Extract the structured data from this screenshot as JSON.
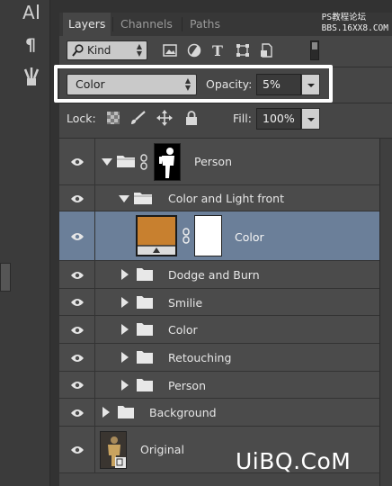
{
  "watermark": {
    "line1": "PS教程论坛",
    "line2": "BBS.16XX8.COM"
  },
  "site_mark": "UiBQ.CoM",
  "toolbar": {
    "tools": [
      {
        "icon": "type-tool-icon"
      },
      {
        "icon": "paragraph-icon"
      },
      {
        "icon": "brush-presets-icon"
      }
    ]
  },
  "tabs": [
    {
      "label": "Layers",
      "active": true
    },
    {
      "label": "Channels",
      "active": false
    },
    {
      "label": "Paths",
      "active": false
    }
  ],
  "filter": {
    "kind_label": "Kind",
    "icons": [
      "image-filter-icon",
      "adjustment-filter-icon",
      "type-filter-icon",
      "shape-filter-icon",
      "smart-object-filter-icon"
    ]
  },
  "blend": {
    "mode": "Color",
    "opacity_label": "Opacity:",
    "opacity_value": "5%"
  },
  "lock": {
    "label": "Lock:",
    "icons": [
      "lock-transparent-icon",
      "lock-image-icon",
      "lock-position-icon",
      "lock-all-icon"
    ],
    "fill_label": "Fill:",
    "fill_value": "100%"
  },
  "layers": [
    {
      "name": "Person",
      "type": "group",
      "expanded": true,
      "depth": 0,
      "has_mask": true
    },
    {
      "name": "Color and Light front",
      "type": "group",
      "expanded": true,
      "depth": 1
    },
    {
      "name": "Color",
      "type": "fill",
      "depth": 2,
      "selected": true,
      "fill_color": "#c8802f"
    },
    {
      "name": "Dodge and Burn",
      "type": "group",
      "expanded": false,
      "depth": 1
    },
    {
      "name": "Smilie",
      "type": "group",
      "expanded": false,
      "depth": 1
    },
    {
      "name": "Color",
      "type": "group",
      "expanded": false,
      "depth": 1
    },
    {
      "name": "Retouching",
      "type": "group",
      "expanded": false,
      "depth": 1
    },
    {
      "name": "Person",
      "type": "group",
      "expanded": false,
      "depth": 1
    },
    {
      "name": "Background",
      "type": "group",
      "expanded": false,
      "depth": 0
    },
    {
      "name": "Original",
      "type": "smart-object",
      "depth": 0
    }
  ],
  "colors": {
    "selection": "#6b7f99",
    "panel": "#464646",
    "highlight": "#ffffff"
  }
}
